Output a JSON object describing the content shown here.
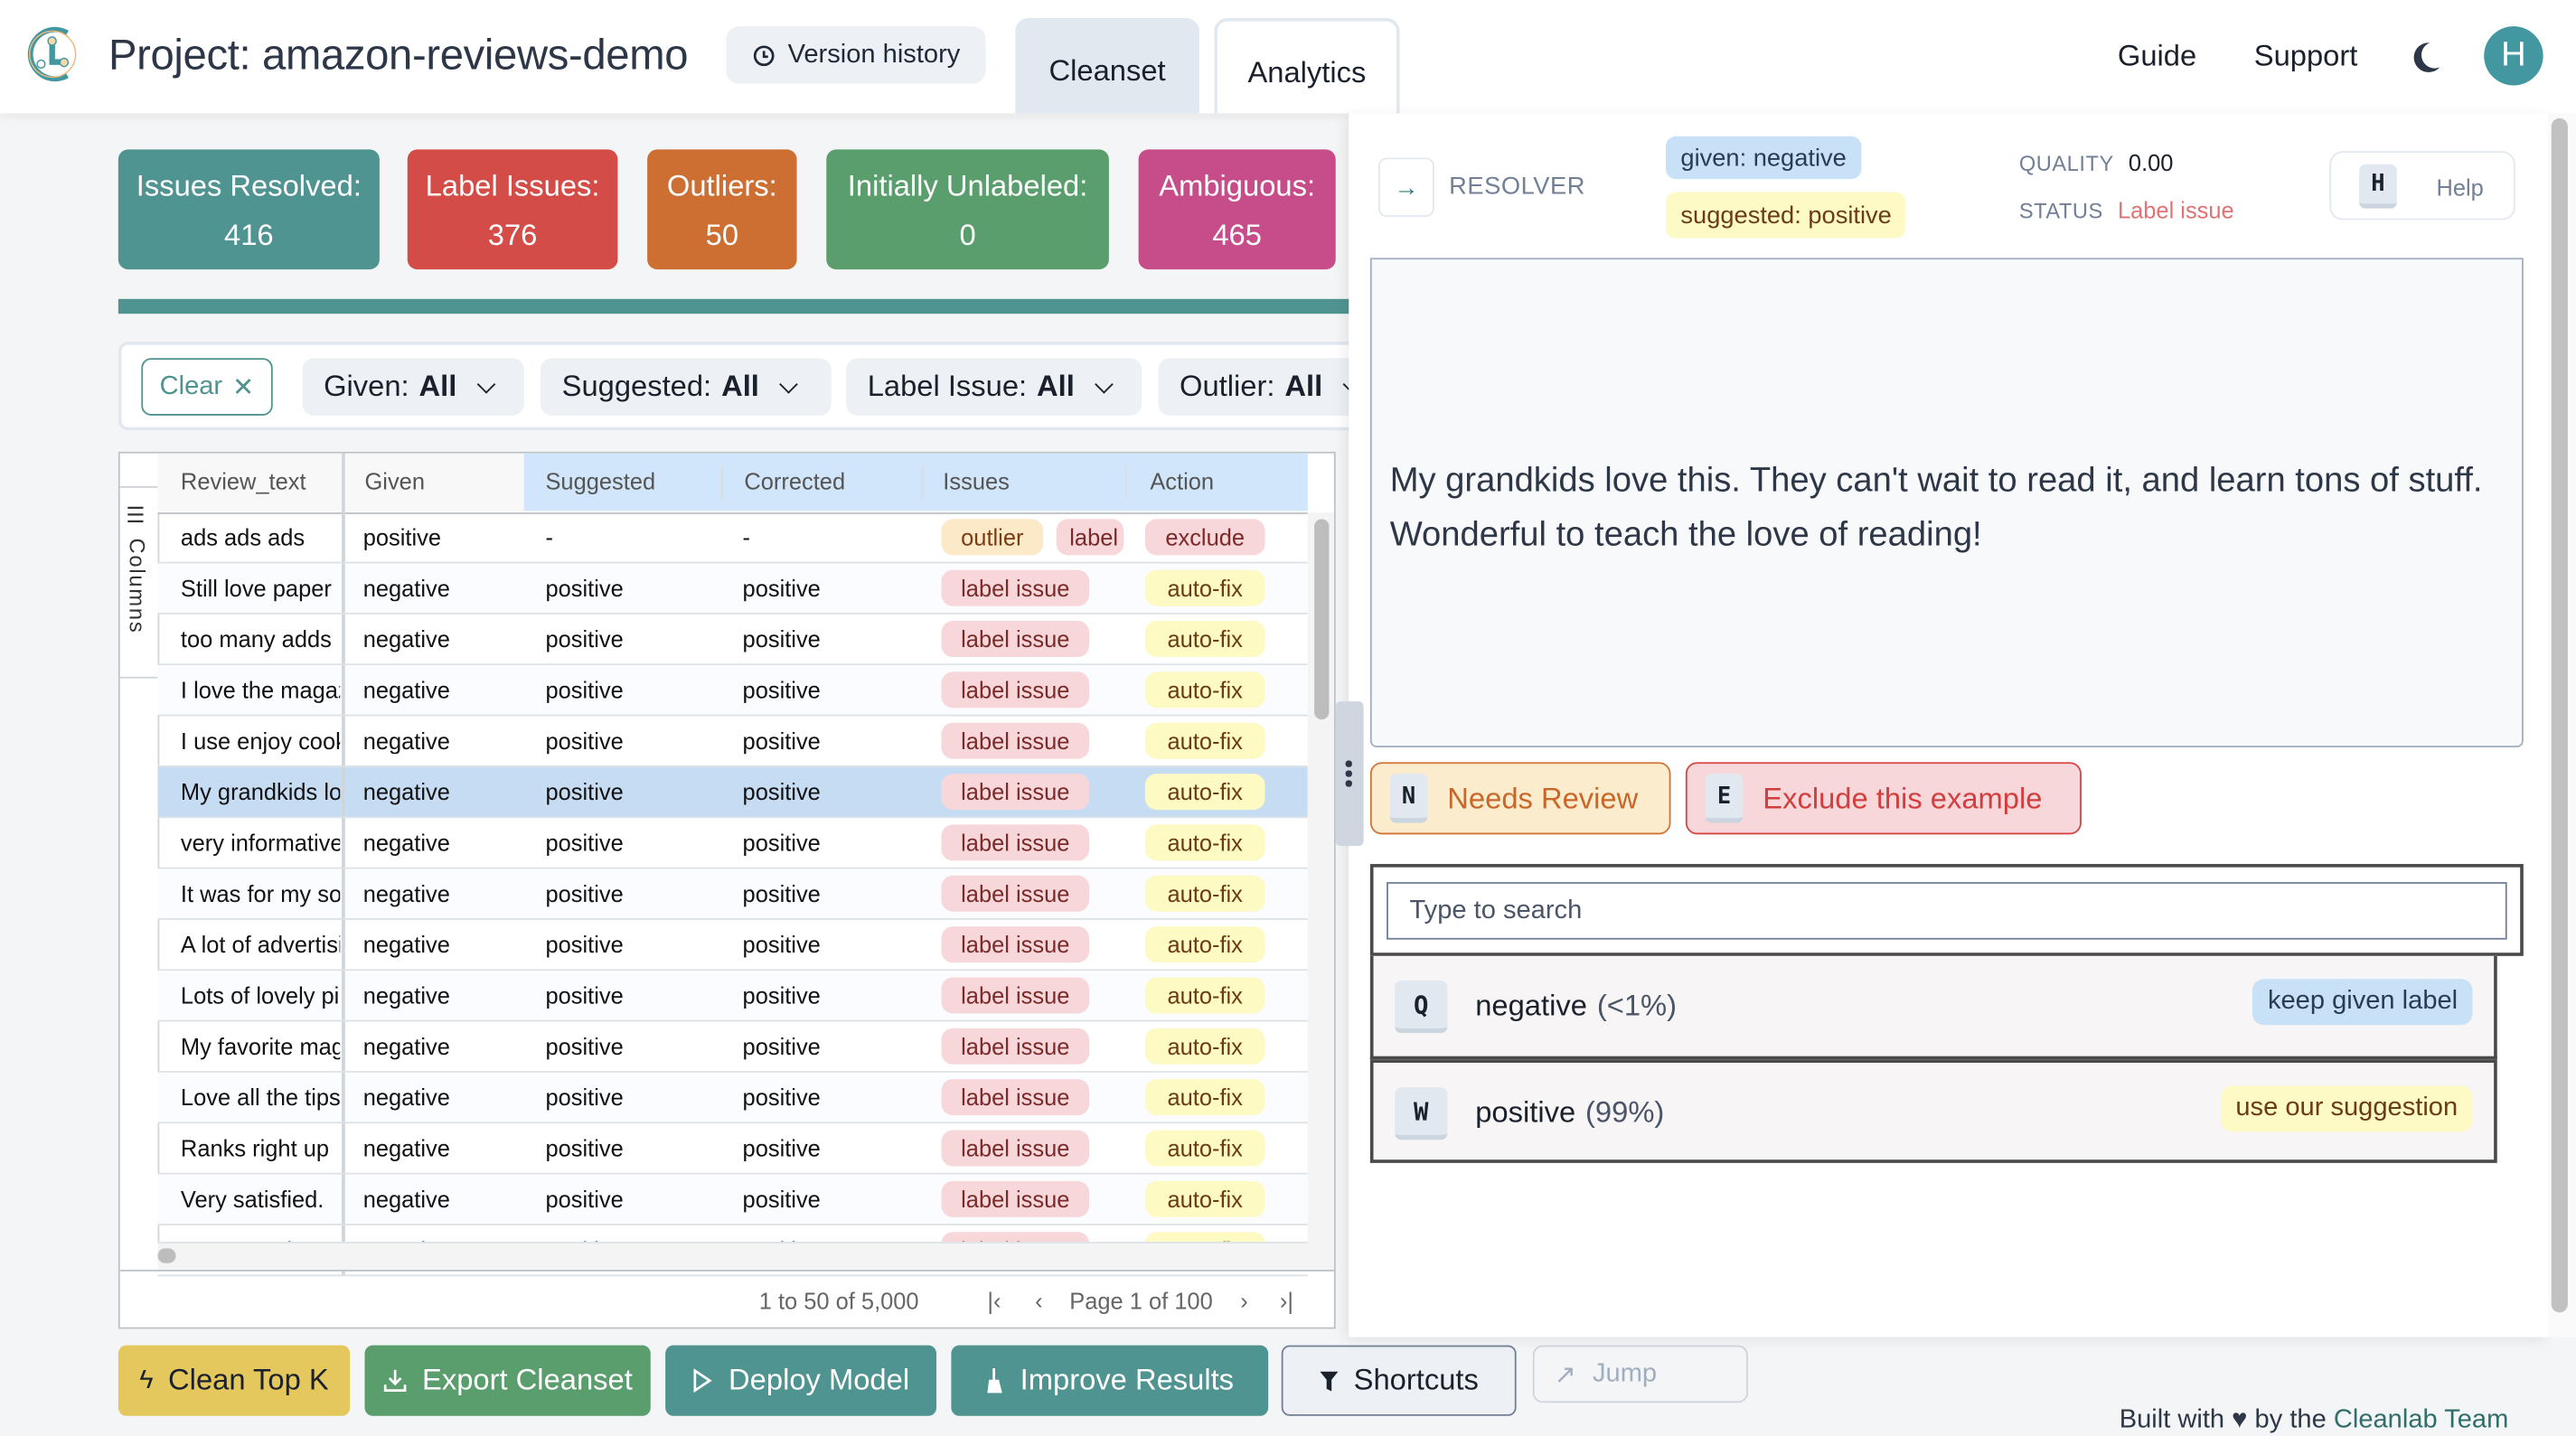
{
  "header": {
    "project_title": "Project: amazon-reviews-demo",
    "version_history": "Version history",
    "tabs": [
      {
        "label": "Cleanset",
        "active": true
      },
      {
        "label": "Analytics",
        "active": false
      }
    ],
    "links": [
      "Guide",
      "Support"
    ],
    "avatar_initial": "H",
    "icons": {
      "logo": "cleanlab-logo-icon",
      "history": "clock-icon",
      "theme": "moon-icon"
    }
  },
  "stats": [
    {
      "label": "Issues Resolved:",
      "value": "416",
      "color": "#509491"
    },
    {
      "label": "Label Issues:",
      "value": "376",
      "color": "#d44c47"
    },
    {
      "label": "Outliers:",
      "value": "50",
      "color": "#cd6f33"
    },
    {
      "label": "Initially Unlabeled:",
      "value": "0",
      "color": "#5a9e6d"
    },
    {
      "label": "Ambiguous:",
      "value": "465",
      "color": "#c64d8a"
    }
  ],
  "progress_fraction": 1.0,
  "filters": {
    "clear": "Clear",
    "items": [
      {
        "key": "Given:",
        "value": "All"
      },
      {
        "key": "Suggested:",
        "value": "All"
      },
      {
        "key": "Label Issue:",
        "value": "All"
      },
      {
        "key": "Outlier:",
        "value": "All"
      }
    ]
  },
  "table": {
    "side_panel_label": "Columns",
    "columns": [
      "Review_text",
      "Given",
      "Suggested",
      "Corrected",
      "Issues",
      "Action"
    ],
    "rows": [
      {
        "text": "ads ads ads",
        "given": "positive",
        "suggested": "-",
        "corrected": "-",
        "issues": [
          "outlier",
          "label"
        ],
        "action": "exclude",
        "selected": false
      },
      {
        "text": "Still love paper",
        "given": "negative",
        "suggested": "positive",
        "corrected": "positive",
        "issues": [
          "label issue"
        ],
        "action": "auto-fix",
        "selected": false
      },
      {
        "text": "too many adds",
        "given": "negative",
        "suggested": "positive",
        "corrected": "positive",
        "issues": [
          "label issue"
        ],
        "action": "auto-fix",
        "selected": false
      },
      {
        "text": "I love the magazine",
        "given": "negative",
        "suggested": "positive",
        "corrected": "positive",
        "issues": [
          "label issue"
        ],
        "action": "auto-fix",
        "selected": false
      },
      {
        "text": "I use enjoy cooking",
        "given": "negative",
        "suggested": "positive",
        "corrected": "positive",
        "issues": [
          "label issue"
        ],
        "action": "auto-fix",
        "selected": false
      },
      {
        "text": "My grandkids love this",
        "given": "negative",
        "suggested": "positive",
        "corrected": "positive",
        "issues": [
          "label issue"
        ],
        "action": "auto-fix",
        "selected": true
      },
      {
        "text": "very informative",
        "given": "negative",
        "suggested": "positive",
        "corrected": "positive",
        "issues": [
          "label issue"
        ],
        "action": "auto-fix",
        "selected": false
      },
      {
        "text": "It was for my son",
        "given": "negative",
        "suggested": "positive",
        "corrected": "positive",
        "issues": [
          "label issue"
        ],
        "action": "auto-fix",
        "selected": false
      },
      {
        "text": "A lot of advertising",
        "given": "negative",
        "suggested": "positive",
        "corrected": "positive",
        "issues": [
          "label issue"
        ],
        "action": "auto-fix",
        "selected": false
      },
      {
        "text": "Lots of lovely pictures",
        "given": "negative",
        "suggested": "positive",
        "corrected": "positive",
        "issues": [
          "label issue"
        ],
        "action": "auto-fix",
        "selected": false
      },
      {
        "text": "My favorite magazine",
        "given": "negative",
        "suggested": "positive",
        "corrected": "positive",
        "issues": [
          "label issue"
        ],
        "action": "auto-fix",
        "selected": false
      },
      {
        "text": "Love all the tips",
        "given": "negative",
        "suggested": "positive",
        "corrected": "positive",
        "issues": [
          "label issue"
        ],
        "action": "auto-fix",
        "selected": false
      },
      {
        "text": "Ranks right up",
        "given": "negative",
        "suggested": "positive",
        "corrected": "positive",
        "issues": [
          "label issue"
        ],
        "action": "auto-fix",
        "selected": false
      },
      {
        "text": "Very satisfied.",
        "given": "negative",
        "suggested": "positive",
        "corrected": "positive",
        "issues": [
          "label issue"
        ],
        "action": "auto-fix",
        "selected": false
      },
      {
        "text": "My Aunt Clee",
        "given": "negative",
        "suggested": "positive",
        "corrected": "positive",
        "issues": [
          "label issue"
        ],
        "action": "auto-fix",
        "selected": false
      }
    ],
    "pagination": {
      "range": "1 to 50 of 5,000",
      "page": "Page 1 of 100"
    }
  },
  "bottom_bar": {
    "buttons": [
      {
        "label": "Clean Top K",
        "icon": "lightning-icon",
        "color": "#e5c85d"
      },
      {
        "label": "Export Cleanset",
        "icon": "download-icon",
        "color": "#5a9e6d"
      },
      {
        "label": "Deploy Model",
        "icon": "play-icon",
        "color": "#509491"
      },
      {
        "label": "Improve Results",
        "icon": "broom-icon",
        "color": "#509491"
      },
      {
        "label": "Shortcuts",
        "icon": "filter-icon",
        "color": "#edf1f6"
      }
    ],
    "jump_placeholder": "Jump"
  },
  "footer": {
    "prefix": "Built with",
    "middle": "by the",
    "brand": "Cleanlab Team"
  },
  "resolver": {
    "title": "RESOLVER",
    "given_chip": "given: negative",
    "suggested_chip": "suggested: positive",
    "quality_label": "QUALITY",
    "quality_value": "0.00",
    "status_label": "STATUS",
    "status_value": "Label issue",
    "help_key": "H",
    "help_label": "Help",
    "review_text": "My grandkids love this. They can't wait to read it, and learn tons of stuff. Wonderful to teach the love of reading!",
    "actions": [
      {
        "key": "N",
        "label": "Needs Review"
      },
      {
        "key": "E",
        "label": "Exclude this example"
      }
    ],
    "search_placeholder": "Type to search",
    "options": [
      {
        "key": "Q",
        "label": "negative",
        "pct": "(<1%)",
        "tag": "keep given label"
      },
      {
        "key": "W",
        "label": "positive",
        "pct": "(99%)",
        "tag": "use our suggestion"
      }
    ]
  }
}
